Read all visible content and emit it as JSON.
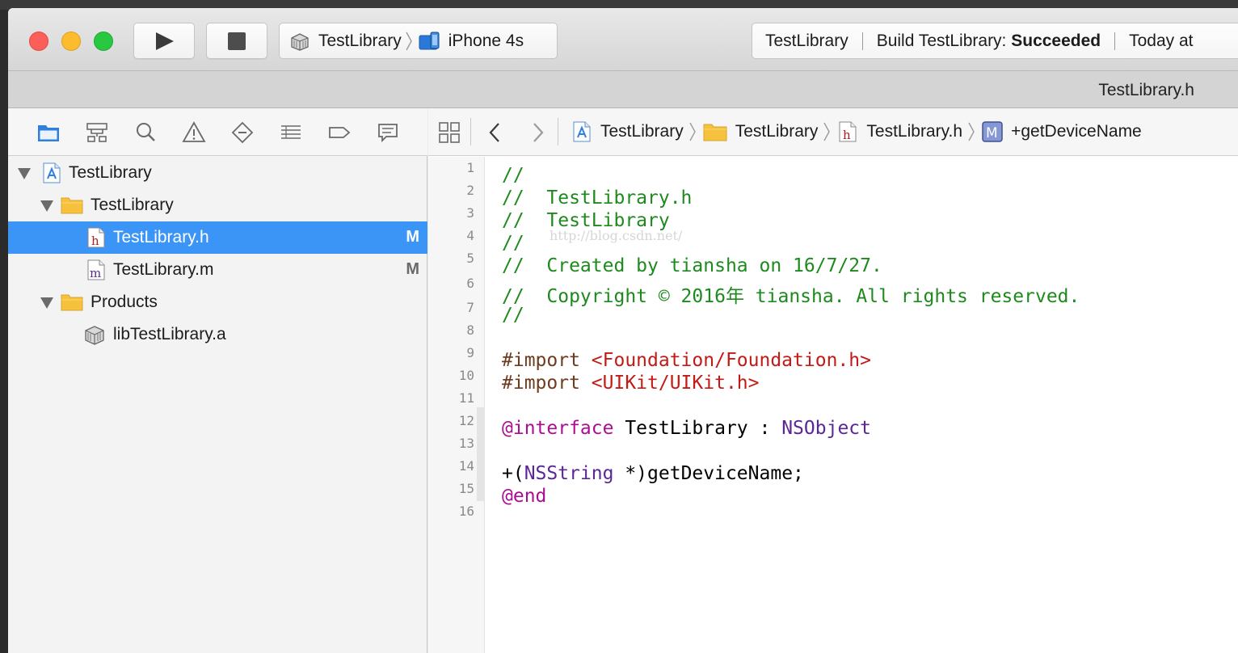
{
  "toolbar": {
    "scheme_name": "TestLibrary",
    "device_name": "iPhone 4s",
    "activity_project": "TestLibrary",
    "activity_status_prefix": "Build TestLibrary: ",
    "activity_status_result": "Succeeded",
    "activity_time": "Today at"
  },
  "tab": {
    "title": "TestLibrary.h"
  },
  "navigator": {
    "toolbar_icons": [
      "folder-icon",
      "hierarchy-icon",
      "search-icon",
      "warning-icon",
      "breakpoint-icon",
      "list-icon",
      "tag-icon",
      "comment-icon"
    ],
    "items": [
      {
        "label": "TestLibrary",
        "icon": "xcode-project-icon",
        "badge": ""
      },
      {
        "label": "TestLibrary",
        "icon": "folder-icon",
        "badge": ""
      },
      {
        "label": "TestLibrary.h",
        "icon": "header-file-icon",
        "badge": "M"
      },
      {
        "label": "TestLibrary.m",
        "icon": "implementation-file-icon",
        "badge": "M"
      },
      {
        "label": "Products",
        "icon": "folder-icon",
        "badge": ""
      },
      {
        "label": "libTestLibrary.a",
        "icon": "static-library-icon",
        "badge": ""
      }
    ]
  },
  "jump_bar": {
    "crumbs": [
      "TestLibrary",
      "TestLibrary",
      "TestLibrary.h",
      "+getDeviceName"
    ]
  },
  "editor": {
    "line_numbers": [
      "1",
      "2",
      "3",
      "4",
      "5",
      "6",
      "7",
      "8",
      "9",
      "10",
      "11",
      "12",
      "13",
      "14",
      "15",
      "16"
    ],
    "lines": {
      "l1": "//",
      "l2": "//  TestLibrary.h",
      "l3": "//  TestLibrary",
      "l4": "//",
      "l5": "//  Created by tiansha on 16/7/27.",
      "l6": "//  Copyright © 2016年 tiansha. All rights reserved.",
      "l7": "//",
      "l9_directive": "#import ",
      "l9_string": "<Foundation/Foundation.h>",
      "l10_directive": "#import ",
      "l10_string": "<UIKit/UIKit.h>",
      "l12_keyword": "@interface",
      "l12_mid": " TestLibrary : ",
      "l12_type": "NSObject",
      "l14_pre": "+(",
      "l14_type": "NSString",
      "l14_post": " *)getDeviceName;",
      "l15_keyword": "@end"
    },
    "watermark": "http://blog.csdn.net/"
  },
  "colors": {
    "selection": "#3b95f7",
    "comment": "#1e8a1e",
    "string": "#c41a16",
    "keyword": "#aa0d91",
    "type": "#5c2699"
  }
}
